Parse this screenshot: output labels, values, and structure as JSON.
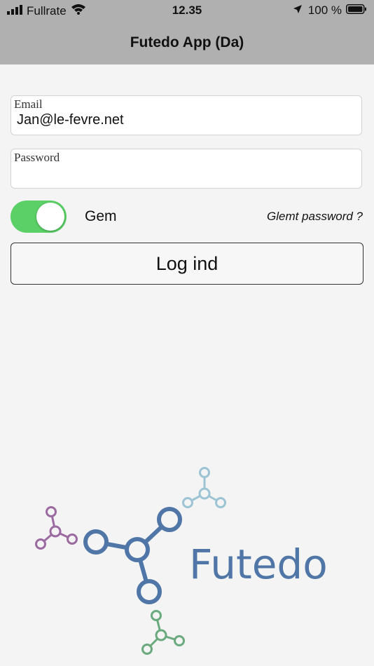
{
  "status_bar": {
    "carrier": "Fullrate",
    "time": "12.35",
    "battery": "100 %"
  },
  "nav": {
    "title": "Futedo App (Da)"
  },
  "form": {
    "email_label": "Email",
    "email_value": "Jan@le-fevre.net",
    "password_label": "Password",
    "password_value": "",
    "remember_label": "Gem",
    "remember_on": true,
    "forgot_label": "Glemt password ?",
    "login_label": "Log ind"
  },
  "logo": {
    "text": "Futedo"
  },
  "colors": {
    "header_bg": "#b0b0b0",
    "page_bg": "#f4f4f4",
    "toggle_on": "#5bd066",
    "logo_blue": "#4f76a6",
    "logo_purple": "#9a6aa0",
    "logo_lightblue": "#9cc4d4",
    "logo_green": "#6aaa7e"
  }
}
